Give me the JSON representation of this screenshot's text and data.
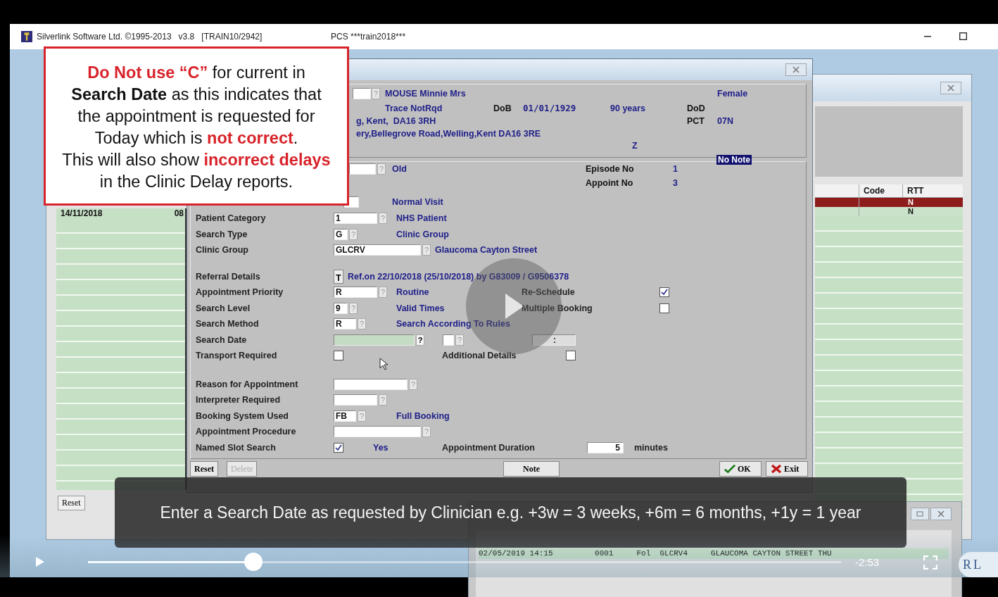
{
  "app": {
    "title": "Silverlink Software Ltd. ©1995-2013   v3.8   [TRAIN10/2942]",
    "subtitle": "PCS ***train2018***"
  },
  "annotation": "**Do Not use “C”** for current in\n**Search Date** as this indicates that\nthe appointment is requested for\nToday which is **not correct**.\nThis will also show **incorrect delays**\nin the Clinic Delay reports.",
  "back_window": {
    "columns": [
      "Code",
      "RTT"
    ],
    "rows": [
      {
        "rtt": "N",
        "selected": true
      },
      {
        "rtt": "N",
        "selected": false
      }
    ],
    "list_rows": [
      {
        "date": "14/11/2018",
        "time": "08"
      }
    ],
    "buttons": [
      "Reset"
    ]
  },
  "dialog": {
    "header": {
      "help": "?",
      "name": "MOUSE Minnie Mrs",
      "gender": "Female",
      "trace": "Trace NotRqd",
      "dob_label": "DoB",
      "dob": "01/01/1929",
      "age": "90 years",
      "dod_label": "DoD",
      "address_1": "g, Kent,  DA16 3RH",
      "pct_label": "PCT",
      "pct": "07N",
      "address_2": "ery,Bellegrove Road,Welling,Kent DA16 3RE",
      "flag": "Z"
    },
    "visit": {
      "help": "?",
      "status": "Old",
      "note": "No Note",
      "episode_label": "Episode No",
      "episode": "1",
      "appoint_label": "Appoint No",
      "appoint": "3",
      "visit_type": "Normal Visit"
    },
    "form_groups": [
      [
        {
          "kind": "field",
          "label": "Patient Category",
          "field": {
            "value": "1",
            "kind": "medium"
          },
          "help": "?",
          "description": "NHS Patient"
        },
        {
          "kind": "field",
          "label": "Search Type",
          "field": {
            "value": "G",
            "kind": "narrow"
          },
          "help": "?",
          "description": "Clinic Group"
        },
        {
          "kind": "field",
          "label": "Clinic Group",
          "field": {
            "value": "GLCRV",
            "kind": "long"
          },
          "help": "?",
          "description": "Glaucoma Cayton Street"
        }
      ],
      [
        {
          "kind": "button",
          "label": "Referral Details",
          "button": "T",
          "description": "Ref.on 22/10/2018 (25/10/2018) by G83009 / G9506378"
        },
        {
          "kind": "field",
          "label": "Appointment Priority",
          "field": {
            "value": "R",
            "kind": "medium"
          },
          "help": "?",
          "description": "Routine",
          "extra": {
            "kind": "check-far",
            "label": "Re-Schedule",
            "checked": true
          }
        },
        {
          "kind": "field",
          "label": "Search Level",
          "field": {
            "value": "9",
            "kind": "narrow"
          },
          "help": "?",
          "description": "Valid Times",
          "extra": {
            "kind": "check-far",
            "label": "Multiple Booking",
            "checked": false
          }
        },
        {
          "kind": "field",
          "label": "Search Method",
          "field": {
            "value": "R",
            "kind": "short"
          },
          "help": "?",
          "description": "Search According To Rules"
        },
        {
          "kind": "field",
          "label": "Search Date",
          "field": {
            "kind": "date",
            "focused": true
          },
          "help": "?",
          "extra": {
            "kind": "date-extra",
            "help": "?",
            "separator": ":"
          }
        },
        {
          "kind": "checkbox",
          "label": "Transport Required",
          "checked": false,
          "extra": {
            "kind": "check-mid",
            "label": "Additional Details",
            "checked": false
          }
        }
      ],
      [
        {
          "kind": "field",
          "label": "Reason for Appointment",
          "field": {
            "kind": "wide"
          },
          "help": "?"
        },
        {
          "kind": "field",
          "label": "Interpreter Required",
          "field": {
            "kind": "medium"
          },
          "help": "?"
        },
        {
          "kind": "field",
          "label": "Booking System Used",
          "field": {
            "value": "FB",
            "kind": "short"
          },
          "help": "?",
          "description": "Full Booking"
        },
        {
          "kind": "field",
          "label": "Appointment Procedure",
          "field": {
            "kind": "long"
          },
          "help": "?"
        },
        {
          "kind": "checkbox",
          "label": "Named Slot Search",
          "checked": true,
          "description": "Yes",
          "extra": {
            "kind": "duration",
            "label": "Appointment Duration",
            "value": "5",
            "unit": "minutes"
          }
        }
      ]
    ],
    "buttons": [
      {
        "label": "Reset",
        "disabled": false
      },
      {
        "label": "Delete",
        "disabled": true
      },
      {
        "label": "Note",
        "disabled": false
      },
      {
        "label": "OK",
        "disabled": false
      },
      {
        "label": "Exit",
        "disabled": false
      }
    ]
  },
  "appointments": {
    "row": "02/05/2019 14:15         0001     Fol  GLCRV4     GLAUCOMA CAYTON STREET THU"
  },
  "player": {
    "caption": "Enter a Search Date as requested by Clinician e.g. +3w = 3 weeks, +6m = 6 months, +1y = 1 year",
    "level": 0.22,
    "time": "-2:53",
    "logo": "RL"
  }
}
